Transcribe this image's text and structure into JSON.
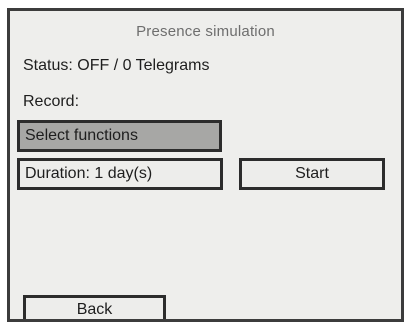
{
  "screen": {
    "title": "Presence simulation",
    "status_text": "Status: OFF / 0 Telegrams",
    "record_label": "Record:",
    "select_functions_label": "Select functions",
    "duration_label": "Duration: 1 day(s)",
    "start_label": "Start",
    "back_label": "Back"
  },
  "colors": {
    "background": "#eeeeec",
    "border": "#2c2c2c",
    "selected_fill": "#a7a7a5",
    "title_text": "#6e6e6e"
  }
}
